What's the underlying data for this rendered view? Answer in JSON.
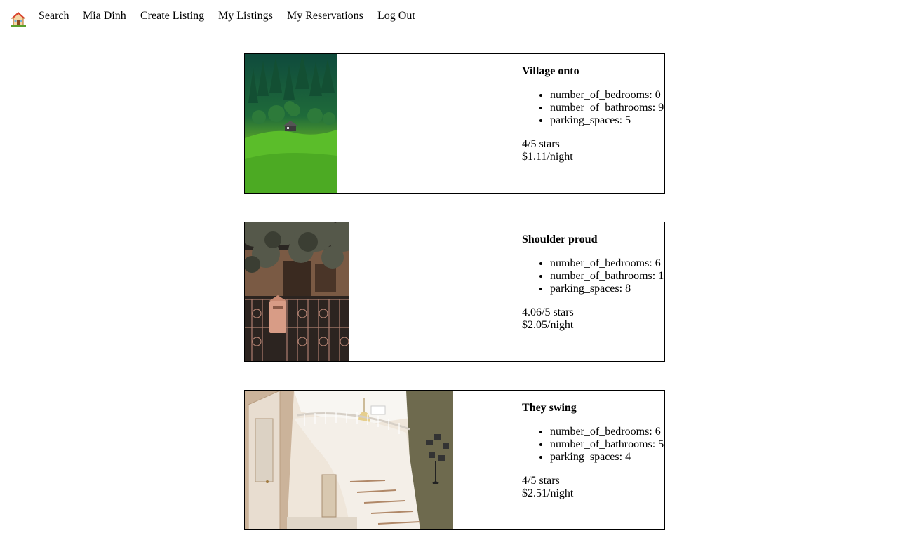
{
  "nav": {
    "home_icon": "house-emoji-icon",
    "links": [
      "Search",
      "Mia Dinh",
      "Create Listing",
      "My Listings",
      "My Reservations",
      "Log Out"
    ]
  },
  "listings": [
    {
      "title": "Village onto",
      "features": [
        "number_of_bedrooms: 0",
        "number_of_bathrooms: 9",
        "parking_spaces: 5"
      ],
      "rating": "4/5 stars",
      "price": "$1.11/night",
      "image": "green-hillside-house-photo"
    },
    {
      "title": "Shoulder proud",
      "features": [
        "number_of_bedrooms: 6",
        "number_of_bathrooms: 1",
        "parking_spaces: 8"
      ],
      "rating": "4.06/5 stars",
      "price": "$2.05/night",
      "image": "ornate-gate-mailbox-photo"
    },
    {
      "title": "They swing",
      "features": [
        "number_of_bedrooms: 6",
        "number_of_bathrooms: 5",
        "parking_spaces: 4"
      ],
      "rating": "4/5 stars",
      "price": "$2.51/night",
      "image": "curved-staircase-interior-photo"
    }
  ]
}
